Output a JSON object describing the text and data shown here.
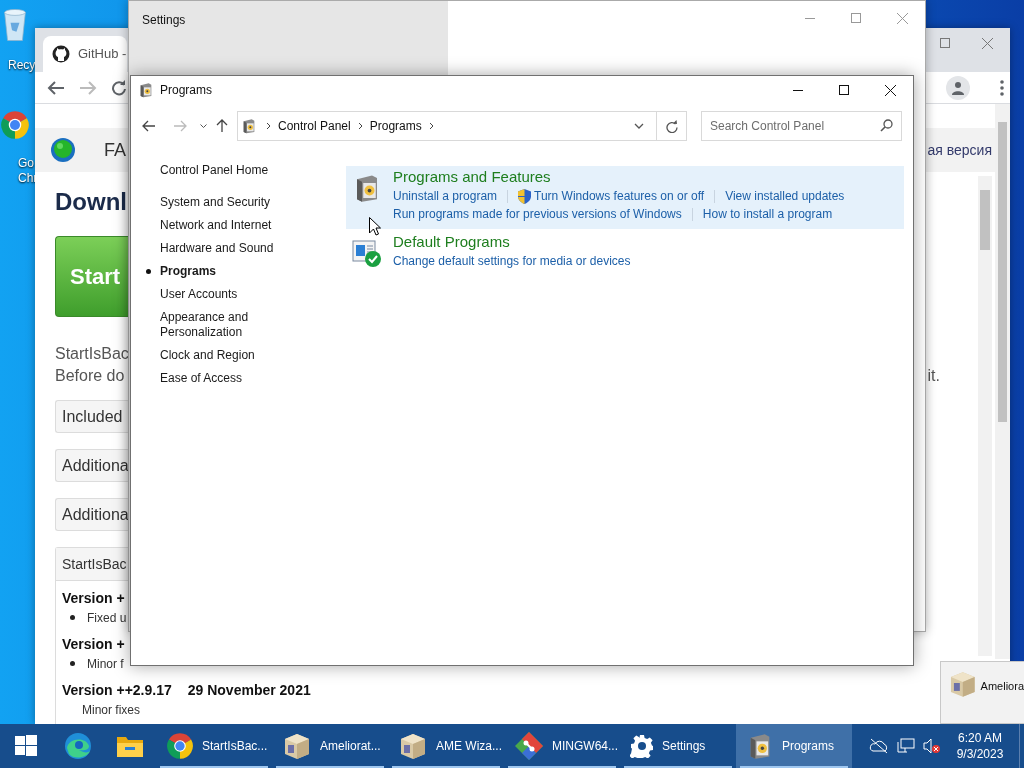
{
  "desktop": {
    "icons": [
      {
        "kind": "recycle",
        "lines": [
          "Recy"
        ]
      },
      {
        "kind": "chrome",
        "lines": [
          "Go",
          "Chr"
        ]
      }
    ]
  },
  "browser": {
    "tab_title": "GitHub -",
    "site_title": "FA",
    "language_link": "ая версия",
    "heading": "Downl",
    "download_button": "Start",
    "intro_lines": [
      "StartIsBac",
      "Before do"
    ],
    "intro_end": "it.",
    "panels": [
      "Included",
      "Additiona",
      "Additiona"
    ],
    "changelog": {
      "title": "StartIsBac",
      "entries": [
        {
          "version": "Version +",
          "items": [
            "Fixed u"
          ]
        },
        {
          "version": "Version +",
          "items": [
            "Minor f"
          ]
        },
        {
          "version": "Version ++2.9.17",
          "date": "29 November 2021",
          "items": [
            "Minor fixes"
          ]
        }
      ]
    }
  },
  "settings": {
    "title": "Settings"
  },
  "control_panel": {
    "title": "Programs",
    "breadcrumb": [
      "Control Panel",
      "Programs"
    ],
    "search_placeholder": "Search Control Panel",
    "home_link": "Control Panel Home",
    "nav": [
      {
        "label": "System and Security",
        "selected": false
      },
      {
        "label": "Network and Internet",
        "selected": false
      },
      {
        "label": "Hardware and Sound",
        "selected": false
      },
      {
        "label": "Programs",
        "selected": true
      },
      {
        "label": "User Accounts",
        "selected": false
      },
      {
        "label": "Appearance and Personalization",
        "selected": false
      },
      {
        "label": "Clock and Region",
        "selected": false
      },
      {
        "label": "Ease of Access",
        "selected": false
      }
    ],
    "categories": [
      {
        "kind": "programs",
        "title": "Programs and Features",
        "hovered": true,
        "link_rows": [
          [
            {
              "text": "Uninstall a program",
              "shield": false
            },
            {
              "text": "Turn Windows features on or off",
              "shield": true
            },
            {
              "text": "View installed updates",
              "shield": false
            }
          ],
          [
            {
              "text": "Run programs made for previous versions of Windows",
              "shield": false
            },
            {
              "text": "How to install a program",
              "shield": false
            }
          ]
        ]
      },
      {
        "kind": "defaults",
        "title": "Default Programs",
        "hovered": false,
        "link_rows": [
          [
            {
              "text": "Change default settings for media or devices",
              "shield": false
            }
          ]
        ]
      }
    ]
  },
  "taskbar": {
    "items": [
      {
        "kind": "start"
      },
      {
        "kind": "edge"
      },
      {
        "kind": "explorer"
      },
      {
        "kind": "chrome",
        "label": "StartIsBac...",
        "active": false
      },
      {
        "kind": "box",
        "label": "Ameliorat...",
        "active": false
      },
      {
        "kind": "box",
        "label": "AME Wiza...",
        "active": false
      },
      {
        "kind": "git",
        "label": "MINGW64...",
        "active": false
      },
      {
        "kind": "gear",
        "label": "Settings",
        "active": false
      },
      {
        "kind": "cp",
        "label": "Programs",
        "active": true
      }
    ],
    "time": "6:20 AM",
    "date": "9/3/2023"
  },
  "preview": {
    "label": "Ameliora"
  }
}
